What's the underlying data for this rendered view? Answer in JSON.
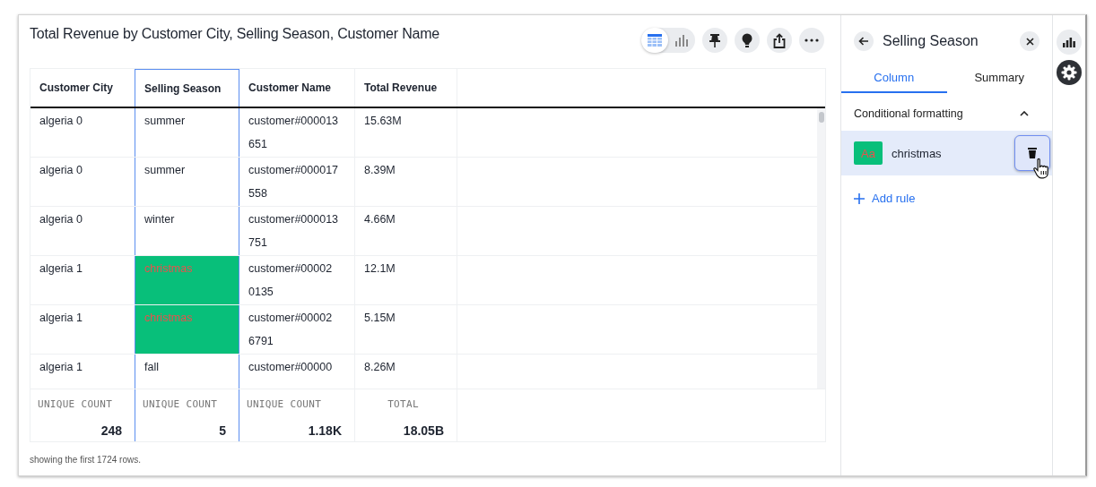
{
  "title": "Total Revenue by Customer City, Selling Season, Customer Name",
  "view_toggle": [
    {
      "kind": "table",
      "selected": true
    },
    {
      "kind": "chart",
      "selected": false
    }
  ],
  "toolbar": [
    {
      "kind": "pin"
    },
    {
      "kind": "bulb"
    },
    {
      "kind": "share"
    },
    {
      "kind": "more"
    }
  ],
  "table": {
    "columns": [
      {
        "label": "Customer City",
        "selected": false
      },
      {
        "label": "Selling Season",
        "selected": true
      },
      {
        "label": "Customer Name",
        "selected": false
      },
      {
        "label": "Total Revenue",
        "selected": false
      }
    ],
    "rows": [
      {
        "cells": [
          {
            "text": "algeria 0"
          },
          {
            "text": "summer",
            "highlighted": false
          },
          {
            "text": "customer#000013",
            "text2": "651"
          },
          {
            "text": "15.63M"
          }
        ]
      },
      {
        "cells": [
          {
            "text": "algeria 0"
          },
          {
            "text": "summer",
            "highlighted": false
          },
          {
            "text": "customer#000017",
            "text2": "558"
          },
          {
            "text": "8.39M"
          }
        ]
      },
      {
        "cells": [
          {
            "text": "algeria 0"
          },
          {
            "text": "winter",
            "highlighted": false
          },
          {
            "text": "customer#000013",
            "text2": "751"
          },
          {
            "text": "4.66M"
          }
        ]
      },
      {
        "cells": [
          {
            "text": "algeria 1"
          },
          {
            "text": "christmas",
            "highlighted": true
          },
          {
            "text": "customer#00002",
            "text2": "0135"
          },
          {
            "text": "12.1M"
          }
        ]
      },
      {
        "cells": [
          {
            "text": "algeria 1"
          },
          {
            "text": "christmas",
            "highlighted": true
          },
          {
            "text": "customer#00002",
            "text2": "6791"
          },
          {
            "text": "5.15M"
          }
        ]
      },
      {
        "cells": [
          {
            "text": "algeria 1"
          },
          {
            "text": "fall",
            "highlighted": false
          },
          {
            "text": "customer#00000"
          },
          {
            "text": "8.26M"
          }
        ]
      }
    ],
    "summary": [
      {
        "label": "UNIQUE COUNT",
        "value": "248"
      },
      {
        "label": "UNIQUE COUNT",
        "value": "5"
      },
      {
        "label": "UNIQUE COUNT",
        "value": "1.18K"
      },
      {
        "label": "TOTAL",
        "value": "18.05B"
      }
    ]
  },
  "note": "showing the first 1724 rows.",
  "panel": {
    "title": "Selling Season",
    "tabs": [
      {
        "label": "Column",
        "selected": true
      },
      {
        "label": "Summary",
        "selected": false
      }
    ],
    "section": {
      "title": "Conditional formatting",
      "expanded": true,
      "rules": [
        {
          "preview": "Aa",
          "label": "christmas",
          "selected": true
        }
      ],
      "add": "Add rule"
    }
  },
  "rail": [
    {
      "kind": "chart",
      "selected": false
    },
    {
      "kind": "settings",
      "selected": true
    }
  ]
}
